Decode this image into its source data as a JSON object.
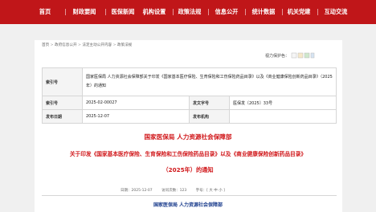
{
  "nav": {
    "items": [
      "首页",
      "财政要闻",
      "医保新闻",
      "机构设置",
      "政策法规",
      "信息公开",
      "统计数据",
      "机关党建",
      "互动交流"
    ]
  },
  "breadcrumb": [
    "首页",
    "政府信息公开",
    "法定主动公开内容",
    "政策法规"
  ],
  "guard_label": "视力保护色：",
  "meta": {
    "row1_label": "索引号",
    "row1_text": "国家医保局 人力资源社会保障部关于印发《国家基本医疗保险、生育保险和工伤保险药品目录》以及《商业健康保险创新药品目录》（2025年）的通知",
    "id_label": "索引号",
    "id_value": "2025-02-00027",
    "docno_label": "发文字号",
    "docno_value": "医保发〔2025〕33号",
    "date_label": "发布日期",
    "date_value": "2025-12-07",
    "org_label": "发布机构",
    "org_value": ""
  },
  "title": {
    "line1": "国家医保局 人力资源社会保障部",
    "line2": "关于印发《国家基本医疗保险、生育保险和工伤保险药品目录》以及《商业健康保险创新药品目录》",
    "line3": "（2025年）的通知"
  },
  "info": {
    "date": "日期：2025-12-07",
    "views": "访问次数：123",
    "font": "字号：[ 大 中 小 ]"
  },
  "body_start": "国家医保局 人力资源社会保障部",
  "colors": {
    "brand_red": "#c01619",
    "title_red": "#d01619",
    "link_blue": "#1a3c8c"
  }
}
